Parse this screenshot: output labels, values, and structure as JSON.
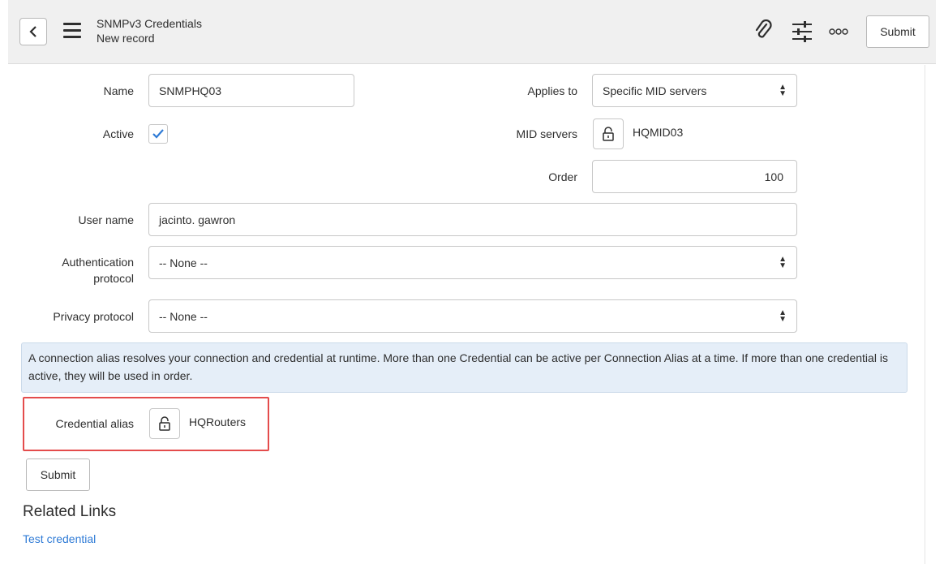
{
  "header": {
    "title": "SNMPv3 Credentials",
    "subtitle": "New record",
    "submit_label": "Submit"
  },
  "form": {
    "name_label": "Name",
    "name_value": "SNMPHQ03",
    "active_label": "Active",
    "active_checked": true,
    "applies_to_label": "Applies to",
    "applies_to_value": "Specific MID servers",
    "mid_servers_label": "MID servers",
    "mid_servers_value": "HQMID03",
    "order_label": "Order",
    "order_value": "100",
    "username_label": "User name",
    "username_value": "jacinto. gawron",
    "auth_protocol_label_line1": "Authentication",
    "auth_protocol_label_line2": "protocol",
    "auth_protocol_value": "-- None --",
    "privacy_protocol_label": "Privacy protocol",
    "privacy_protocol_value": "-- None --",
    "info_text": "A connection alias resolves your connection and credential at runtime. More than one Credential can be active per Connection Alias at a time. If more than one credential is active, they will be used in order.",
    "credential_alias_label": "Credential alias",
    "credential_alias_value": "HQRouters",
    "submit_label": "Submit"
  },
  "related": {
    "heading": "Related Links",
    "links": [
      "Test credential"
    ]
  },
  "colors": {
    "accent": "#2f7bd6",
    "highlight_border": "#e44c4c",
    "info_bg": "#e5eef8"
  }
}
